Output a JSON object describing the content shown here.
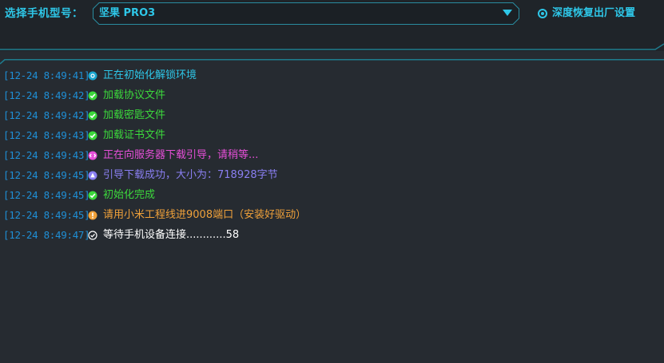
{
  "header": {
    "model_label": "选择手机型号：",
    "model_value": "坚果 PRO3",
    "reset_label": "深度恢复出厂设置",
    "reset_checked": true
  },
  "colors": {
    "accent": "#2ec7e8",
    "time": "#1f8fd6",
    "info": "#2ec7e8",
    "success": "#3cd83c",
    "download": "#e64fd8",
    "upload": "#8a7ff2",
    "warning": "#f0a13a",
    "waiting": "#ffffff"
  },
  "logs": [
    {
      "time": "[12-24 8:49:41]",
      "icon": "info-ring-icon",
      "type": "info",
      "message": "正在初始化解锁环境"
    },
    {
      "time": "[12-24 8:49:42]",
      "icon": "check-circle-icon",
      "type": "success",
      "message": "加载协议文件"
    },
    {
      "time": "[12-24 8:49:42]",
      "icon": "check-circle-icon",
      "type": "success",
      "message": "加载密匙文件"
    },
    {
      "time": "[12-24 8:49:43]",
      "icon": "check-circle-icon",
      "type": "success",
      "message": "加载证书文件"
    },
    {
      "time": "[12-24 8:49:43]",
      "icon": "download-circle-icon",
      "type": "download",
      "message": "正在向服务器下载引导，请稍等..."
    },
    {
      "time": "[12-24 8:49:45]",
      "icon": "upload-circle-icon",
      "type": "upload",
      "message": "引导下载成功，大小为：718928字节"
    },
    {
      "time": "[12-24 8:49:45]",
      "icon": "check-circle-icon",
      "type": "success",
      "message": "初始化完成"
    },
    {
      "time": "[12-24 8:49:45]",
      "icon": "warning-circle-icon",
      "type": "warning",
      "message": "请用小米工程线进9008端口（安装好驱动）"
    },
    {
      "time": "[12-24 8:49:47]",
      "icon": "clock-check-icon",
      "type": "waiting",
      "message": "等待手机设备连接............58"
    }
  ]
}
